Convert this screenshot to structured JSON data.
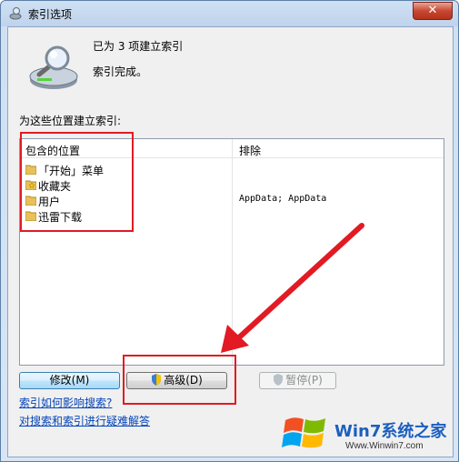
{
  "window": {
    "title": "索引选项",
    "close_glyph": "✕"
  },
  "status": {
    "line1": "已为 3 项建立索引",
    "line2": "索引完成。"
  },
  "section_label": "为这些位置建立索引:",
  "list": {
    "headers": [
      "包含的位置",
      "排除"
    ],
    "rows": [
      {
        "label": "「开始」菜单",
        "icon": "folder-icon"
      },
      {
        "label": "收藏夹",
        "icon": "favorites-folder-icon"
      },
      {
        "label": "用户",
        "icon": "folder-icon"
      },
      {
        "label": "迅雷下载",
        "icon": "folder-icon"
      }
    ],
    "exclude_text": "AppData; AppData"
  },
  "buttons": {
    "modify": "修改(M)",
    "advanced": "高级(D)",
    "pause": "暂停(P)"
  },
  "links": {
    "help1": "索引如何影响搜索?",
    "help2": "对搜索和索引进行疑难解答"
  },
  "watermark": {
    "main": "Win7系统之家",
    "url": "Www.Winwin7.com"
  },
  "colors": {
    "accent": "#0645b7",
    "annotation_red": "#e21a23"
  }
}
